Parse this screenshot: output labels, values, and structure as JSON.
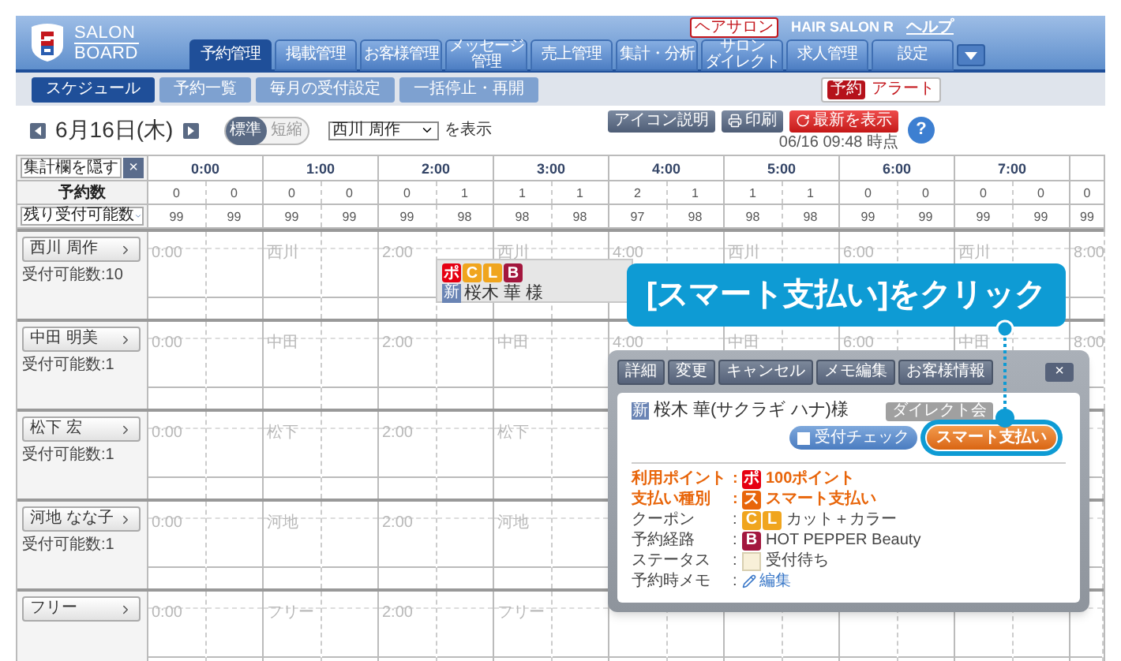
{
  "header": {
    "logo": {
      "line1": "SALON",
      "line2": "BOARD"
    },
    "account": {
      "category": "ヘアサロン",
      "salon": "HAIR SALON R",
      "help": "ヘルプ"
    },
    "nav_tabs": [
      {
        "lines": [
          "予約管理"
        ],
        "selected": true
      },
      {
        "lines": [
          "掲載管理"
        ],
        "selected": false
      },
      {
        "lines": [
          "お客様管理"
        ],
        "selected": false
      },
      {
        "lines": [
          "メッセージ",
          "管理"
        ],
        "selected": false
      },
      {
        "lines": [
          "売上管理"
        ],
        "selected": false
      },
      {
        "lines": [
          "集計・分析"
        ],
        "selected": false
      },
      {
        "lines": [
          "サロン",
          "ダイレクト"
        ],
        "selected": false
      },
      {
        "lines": [
          "求人管理"
        ],
        "selected": false
      },
      {
        "lines": [
          "設定"
        ],
        "selected": false
      }
    ]
  },
  "subnav": {
    "items": [
      {
        "label": "スケジュール",
        "selected": true
      },
      {
        "label": "予約一覧",
        "selected": false
      },
      {
        "label": "毎月の受付設定",
        "selected": false
      },
      {
        "label": "一括停止・再開",
        "selected": false
      }
    ],
    "alert": {
      "badge": "予約",
      "label": "アラート"
    }
  },
  "date_bar": {
    "date": "6月16日(木)",
    "view_toggle": [
      {
        "label": "標準",
        "selected": true
      },
      {
        "label": "短縮",
        "selected": false
      }
    ],
    "staff_select": "西川 周作",
    "select_suffix": "を表示",
    "buttons": [
      {
        "label": "アイコン説明",
        "kind": "plain"
      },
      {
        "label": "印刷",
        "kind": "print"
      },
      {
        "label": "最新を表示",
        "kind": "refresh"
      }
    ],
    "timestamp": "06/16 09:48 時点",
    "help": "?"
  },
  "schedule": {
    "hide_button": "集計欄を隠す",
    "hide_close": "×",
    "hours": [
      "0:00",
      "1:00",
      "2:00",
      "3:00",
      "4:00",
      "5:00",
      "6:00",
      "7:00"
    ],
    "summary_rows": [
      {
        "label": "予約数",
        "kind": "plain",
        "values": [
          "0",
          "0",
          "0",
          "0",
          "0",
          "1",
          "1",
          "1",
          "2",
          "1",
          "1",
          "1",
          "0",
          "0",
          "0",
          "0",
          "0"
        ]
      },
      {
        "label": "残り受付可能数",
        "kind": "dropdown",
        "values": [
          "99",
          "99",
          "99",
          "99",
          "99",
          "98",
          "98",
          "98",
          "97",
          "98",
          "98",
          "98",
          "99",
          "99",
          "99",
          "99",
          "99"
        ]
      }
    ],
    "staff": [
      {
        "name": "西川 周作",
        "capacity": "受付可能数:10",
        "slot_labels": [
          "0:00",
          "西川",
          "2:00",
          "西川",
          "4:00",
          "西川",
          "6:00",
          "西川",
          "8:00"
        ],
        "reservation": {
          "icons": [
            {
              "text": "ポ",
              "color": "#e60012"
            },
            {
              "text": "C",
              "color": "#f0a51e"
            },
            {
              "text": "L",
              "color": "#f0a51e"
            },
            {
              "text": "B",
              "color": "#a3173e"
            }
          ],
          "new_badge": "新",
          "customer": "桜木 華 様"
        }
      },
      {
        "name": "中田 明美",
        "capacity": "受付可能数:1",
        "slot_labels": [
          "0:00",
          "中田",
          "2:00",
          "中田",
          "4:00",
          "中田",
          "6:00",
          "中田",
          "8:00"
        ]
      },
      {
        "name": "松下 宏",
        "capacity": "受付可能数:1",
        "slot_labels": [
          "0:00",
          "松下",
          "2:00",
          "松下"
        ]
      },
      {
        "name": "河地 なな子",
        "capacity": "受付可能数:1",
        "slot_labels": [
          "0:00",
          "河地",
          "2:00",
          "河地"
        ]
      },
      {
        "name": "フリー",
        "slot_labels": [
          "0:00",
          "フリー",
          "2:00",
          "フリー"
        ]
      }
    ]
  },
  "callout": {
    "text": "[スマート支払い]をクリック"
  },
  "popup": {
    "actions": [
      "詳細",
      "変更",
      "キャンセル",
      "メモ編集",
      "お客様情報"
    ],
    "close": "×",
    "new_badge": "新",
    "customer": "桜木 華(サクラギ ハナ)様",
    "member_badge": "ダイレクト会",
    "check_button": {
      "label": "受付チェック",
      "checked": false
    },
    "pay_button": {
      "label": "スマート支払い",
      "highlighted": true
    },
    "details": [
      {
        "label": "利用ポイント",
        "sep": ":",
        "highlighted": true,
        "kind": "badges",
        "icons": [
          {
            "text": "ポ",
            "color": "#e60012"
          }
        ],
        "value": "100ポイント"
      },
      {
        "label": "支払い種別",
        "sep": ":",
        "highlighted": true,
        "kind": "badges",
        "icons": [
          {
            "text": "ス",
            "color": "#e8650a"
          }
        ],
        "value": "スマート支払い"
      },
      {
        "label": "クーポン",
        "sep": ":",
        "highlighted": false,
        "kind": "badges",
        "icons": [
          {
            "text": "C",
            "color": "#f0a51e"
          },
          {
            "text": "L",
            "color": "#f0a51e"
          }
        ],
        "value": "カット＋カラー"
      },
      {
        "label": "予約経路",
        "sep": ":",
        "highlighted": false,
        "kind": "badges",
        "icons": [
          {
            "text": "B",
            "color": "#a3173e"
          }
        ],
        "value": "HOT PEPPER Beauty"
      },
      {
        "label": "ステータス",
        "sep": ":",
        "highlighted": false,
        "kind": "status",
        "color": "#f8f0d8",
        "value": "受付待ち"
      },
      {
        "label": "予約時メモ",
        "sep": ":",
        "highlighted": false,
        "kind": "link",
        "value": "編集"
      }
    ]
  }
}
